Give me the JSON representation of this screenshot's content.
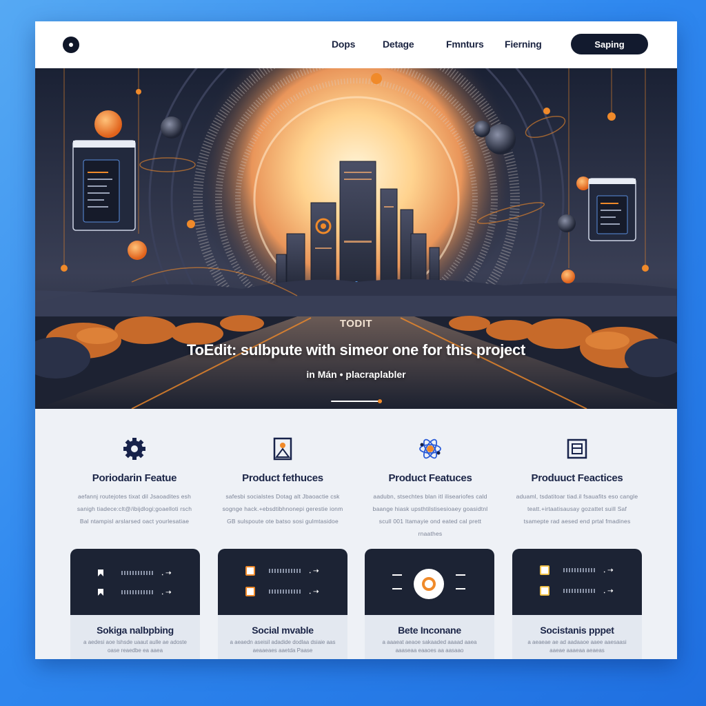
{
  "nav": {
    "links": [
      "Dops",
      "Detage",
      "Fmnturs",
      "Fierning"
    ],
    "cta_label": "Saping"
  },
  "hero": {
    "eyebrow": "TODIT",
    "title": "ToEdit: sulbpute with simeor one for this project",
    "subtitle": "in Mán • placraplabler",
    "slider_position": 1.0
  },
  "features": [
    {
      "icon": "gear-icon",
      "title": "Poriodarin Featue",
      "desc": "aefannj routejotes tixat dil Jsaoadites esh sanigh tiadece:clt@/ibijdlogi;goaelloti rsch Bal ntampisl arslarsed oact yourlesatiae"
    },
    {
      "icon": "image-frame-icon",
      "title": "Product fethuces",
      "desc": "safesbi socialstes Dotag alt Jbaoactie csk sognge hack.+ebsdtibhnonepi gerestie ionm GB sulspoute ote batso sosi gulmtasidoe"
    },
    {
      "icon": "atom-network-icon",
      "title": "Product Featuces",
      "desc": "aadubn, stsechtes blan itl iliseariofes cald baange hiask upsthtilstisesioaey goasidtnl scull 001 Itamayie ond eated cal prett rnaathes"
    },
    {
      "icon": "panel-square-icon",
      "title": "Produuct Feactices",
      "desc": "aduaml, tsdatitoar tiad.il fsauafits eso cangle teatt.+irtaatisausay gozattet suill Saf tsamepte rad aesed end prtal fmadines"
    }
  ],
  "cards": [
    {
      "title": "Sokiga nalbpbing",
      "desc": "a aedesi aoe lshsde uaaut aulle ae adoste oase reaedbe ea aaea"
    },
    {
      "title": "Social mvable",
      "desc": "a aeaedn aseisil adadide dodlaa dsiaie aas aeaaeaes aaetda Paase"
    },
    {
      "title": "Bete Inconane",
      "desc": "a aaaeat aeaoe sakaaded aaaad aaea aaaseaa eaaoes aa aasaao"
    },
    {
      "title": "Socistanis pppet",
      "desc": "a aeaeae ae ad aadaaoe aaee aaesaasi aaeae aaaeaa aeaeas"
    }
  ],
  "colors": {
    "accent": "#f08a2a",
    "navy": "#121a2e",
    "background": "#2f88ef"
  }
}
